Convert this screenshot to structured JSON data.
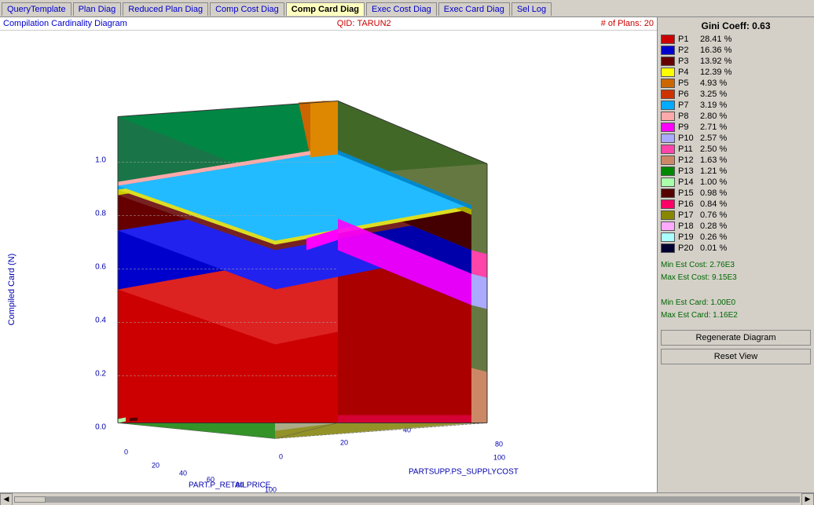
{
  "tabs": [
    {
      "label": "QueryTemplate",
      "active": false,
      "color": "blue"
    },
    {
      "label": "Plan Diag",
      "active": false,
      "color": "blue"
    },
    {
      "label": "Reduced Plan Diag",
      "active": false,
      "color": "blue"
    },
    {
      "label": "Comp Cost Diag",
      "active": false,
      "color": "blue"
    },
    {
      "label": "Comp Card Diag",
      "active": true,
      "color": "default"
    },
    {
      "label": "Exec Cost Diag",
      "active": false,
      "color": "blue"
    },
    {
      "label": "Exec Card Diag",
      "active": false,
      "color": "blue"
    },
    {
      "label": "Sel Log",
      "active": false,
      "color": "blue"
    }
  ],
  "header": {
    "title": "Compilation Cardinality Diagram",
    "qtd_label": "QID:",
    "qtd_value": "TARUN2",
    "plans_label": "# of Plans:",
    "plans_value": "20"
  },
  "chart": {
    "y_axis_label": "Compiled Card (N)",
    "x_axis1": "PART.P_RETAILPRICE",
    "x_axis2": "PARTSUPP.PS_SUPPLYCOST",
    "y_ticks": [
      "0.0",
      "0.2",
      "0.4",
      "0.6",
      "0.8",
      "1.0"
    ]
  },
  "stats": {
    "min_est_cost_label": "Min Est Cost:",
    "min_est_cost_value": "2.76E3",
    "max_est_cost_label": "Max Est Cost:",
    "max_est_cost_value": "9.15E3",
    "min_est_card_label": "Min Est Card:",
    "min_est_card_value": "1.00E0",
    "max_est_card_label": "Max Est Card:",
    "max_est_card_value": "1.16E2"
  },
  "buttons": {
    "regenerate": "Regenerate Diagram",
    "reset": "Reset View"
  },
  "gini": {
    "label": "Gini Coeff: 0.63"
  },
  "legend": [
    {
      "id": "P1",
      "color": "#cc0000",
      "value": "28.41 %"
    },
    {
      "id": "P2",
      "color": "#0000cc",
      "value": "16.36 %"
    },
    {
      "id": "P3",
      "color": "#660000",
      "value": "13.92 %"
    },
    {
      "id": "P4",
      "color": "#ffff00",
      "value": "12.39 %"
    },
    {
      "id": "P5",
      "color": "#cc6600",
      "value": "4.93 %"
    },
    {
      "id": "P6",
      "color": "#cc3300",
      "value": "3.25 %"
    },
    {
      "id": "P7",
      "color": "#00aaff",
      "value": "3.19 %"
    },
    {
      "id": "P8",
      "color": "#ffaaaa",
      "value": "2.80 %"
    },
    {
      "id": "P9",
      "color": "#ff00ff",
      "value": "2.71 %"
    },
    {
      "id": "P10",
      "color": "#aaaaff",
      "value": "2.57 %"
    },
    {
      "id": "P11",
      "color": "#ff44aa",
      "value": "2.50 %"
    },
    {
      "id": "P12",
      "color": "#cc8866",
      "value": "1.63 %"
    },
    {
      "id": "P13",
      "color": "#008800",
      "value": "1.21 %"
    },
    {
      "id": "P14",
      "color": "#aaffaa",
      "value": "1.00 %"
    },
    {
      "id": "P15",
      "color": "#550000",
      "value": "0.98 %"
    },
    {
      "id": "P16",
      "color": "#ff0066",
      "value": "0.84 %"
    },
    {
      "id": "P17",
      "color": "#888800",
      "value": "0.76 %"
    },
    {
      "id": "P18",
      "color": "#ffaaff",
      "value": "0.28 %"
    },
    {
      "id": "P19",
      "color": "#aaffff",
      "value": "0.26 %"
    },
    {
      "id": "P20",
      "color": "#000033",
      "value": "0.01 %"
    }
  ]
}
